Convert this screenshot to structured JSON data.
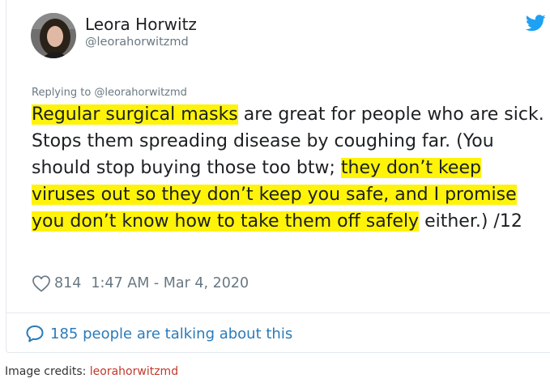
{
  "author": {
    "name": "Leora Horwitz",
    "handle": "@leorahorwitzmd"
  },
  "reply_context": "Replying to @leorahorwitzmd",
  "tweet": {
    "segments": [
      {
        "text": "Regular surgical masks",
        "highlight": true
      },
      {
        "text": " are great for people who are sick. Stops them spreading disease by coughing far. (You should stop buying those too btw; ",
        "highlight": false
      },
      {
        "text": "they don’t keep viruses out so they don’t keep you safe, and I promise you don’t know how to take them off safely",
        "highlight": true
      },
      {
        "text": " either.) /12",
        "highlight": false
      }
    ]
  },
  "meta": {
    "likes": "814",
    "timestamp": "1:47 AM - Mar 4, 2020"
  },
  "conversation": {
    "label": "185 people are talking about this"
  },
  "credits": {
    "label": "Image credits: ",
    "source": "leorahorwitzmd"
  },
  "icons": {
    "twitter": "twitter-bird-icon",
    "like": "heart-icon",
    "reply": "speech-bubble-icon"
  },
  "colors": {
    "highlight": "#fff30a",
    "twitter_blue": "#1da1f2",
    "link_blue": "#2b7bb9",
    "muted_gray": "#697882",
    "credit_link": "#c0392b"
  }
}
